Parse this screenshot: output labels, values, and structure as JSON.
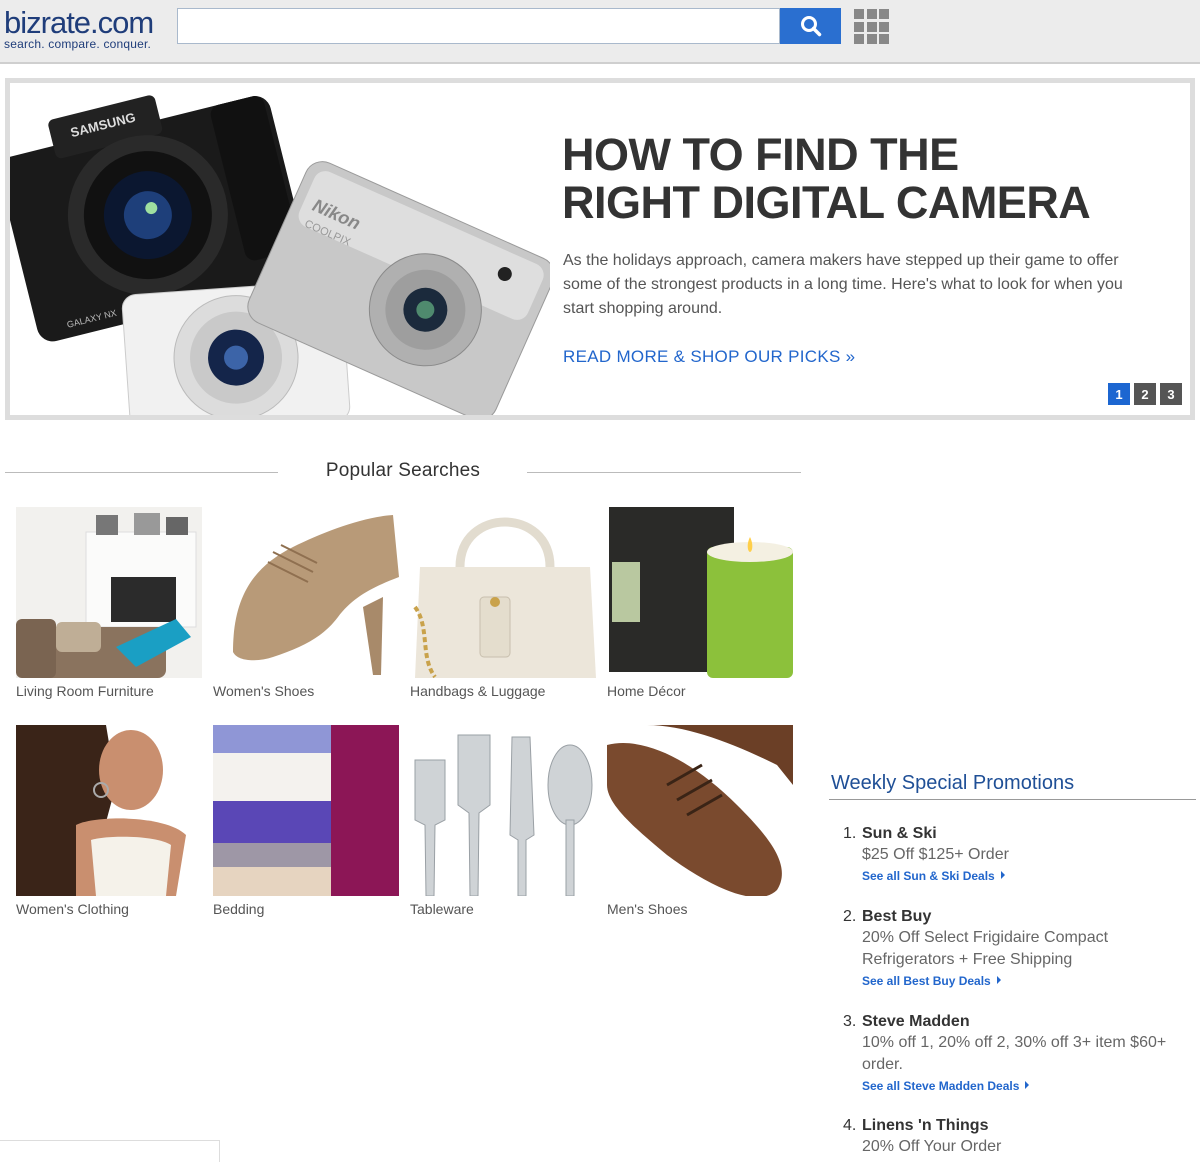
{
  "header": {
    "logo": "bizrate.com",
    "tagline": "search. compare. conquer.",
    "search_placeholder": "",
    "search_icon": "magnifier-icon",
    "apps_icon": "grid-icon"
  },
  "hero": {
    "title_line1": "HOW TO FIND THE",
    "title_line2": "RIGHT DIGITAL CAMERA",
    "body": "As the holidays approach, camera makers have stepped up their game to offer some of the strongest products in a long time. Here's what to look for when you start shopping around.",
    "link": "READ MORE & SHOP OUR PICKS »",
    "pages": [
      "1",
      "2",
      "3"
    ],
    "active_page": "1",
    "camera_brands": [
      "SAMSUNG",
      "GALAXY NX",
      "Nikon",
      "COOLPIX"
    ]
  },
  "popular": {
    "title": "Popular Searches",
    "items": [
      {
        "label": "Living Room Furniture"
      },
      {
        "label": "Women's Shoes"
      },
      {
        "label": "Handbags & Luggage"
      },
      {
        "label": "Home Décor"
      },
      {
        "label": "Women's Clothing"
      },
      {
        "label": "Bedding"
      },
      {
        "label": "Tableware"
      },
      {
        "label": "Men's Shoes"
      }
    ]
  },
  "promotions": {
    "title": "Weekly Special Promotions",
    "items": [
      {
        "num": "1.",
        "name": "Sun & Ski",
        "desc": "$25 Off $125+ Order",
        "link": "See all Sun & Ski Deals"
      },
      {
        "num": "2.",
        "name": "Best Buy",
        "desc": "20% Off Select Frigidaire Compact Refrigerators + Free Shipping",
        "link": "See all Best Buy Deals"
      },
      {
        "num": "3.",
        "name": "Steve Madden",
        "desc": "10% off 1, 20% off 2, 30% off 3+ item $60+ order.",
        "link": "See all Steve Madden Deals"
      },
      {
        "num": "4.",
        "name": "Linens 'n Things",
        "desc": "20% Off Your Order",
        "link": ""
      }
    ]
  },
  "colors": {
    "brand": "#1f3d7a",
    "accent": "#2a6fd0",
    "link": "#2266cc"
  }
}
